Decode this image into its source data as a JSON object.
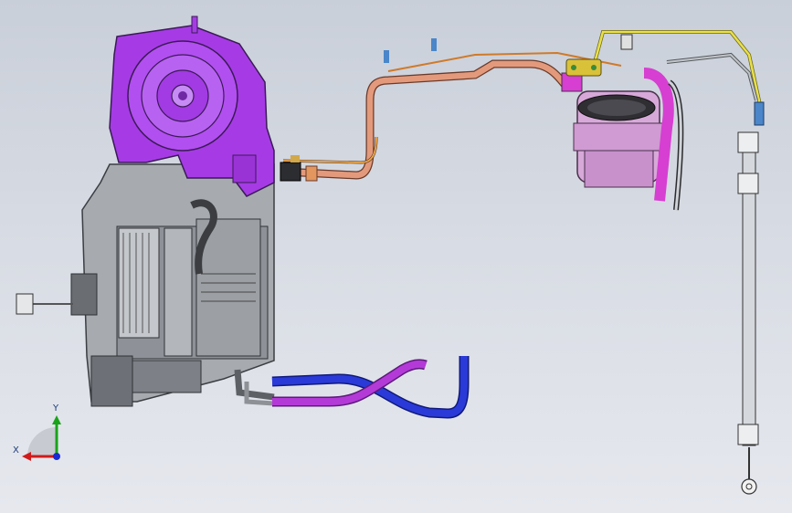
{
  "viewport": {
    "background_top": "#c9cfd9",
    "background_bottom": "#e6e8ee"
  },
  "model": {
    "blower_housing_color": "#a63be6",
    "hvac_case_color": "#8a8f95",
    "refrigerant_line_color": "#e39a7c",
    "compressor_color": "#d7a9d9",
    "compressor_hose_color": "#d63fd1",
    "yellow_line_color": "#e9e04a",
    "heater_hose_blue_color": "#2a3ad8",
    "heater_hose_purple_color": "#b43ad8",
    "accumulator_rod_color": "#d5d8dc"
  },
  "triad": {
    "y_label": "Y",
    "x_label": "X",
    "x_axis_color": "#d11a1a",
    "y_axis_color": "#1aa31a",
    "z_axis_color": "#1a2ad1"
  }
}
